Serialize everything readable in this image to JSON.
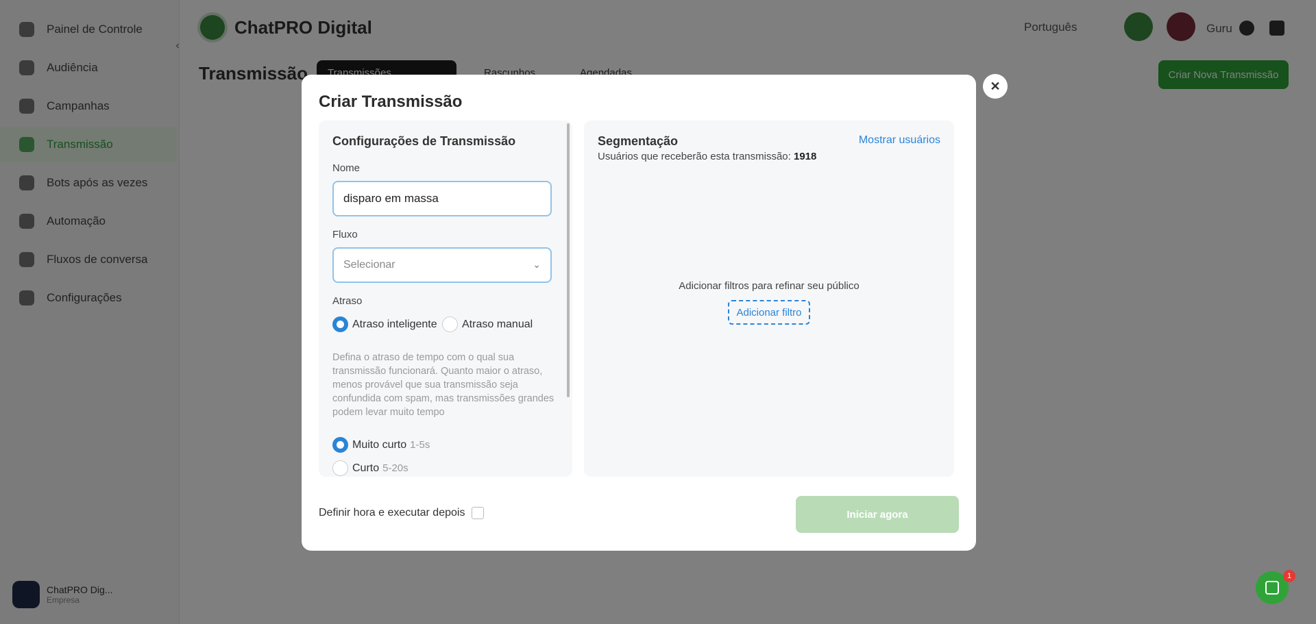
{
  "app": {
    "brand": "ChatPRO Digital",
    "language": "Português",
    "guru_label": "Guru",
    "page_title": "Transmissão",
    "tabs": [
      "Transmissões",
      "Rascunhos",
      "Agendadas"
    ],
    "create_button": "Criar Nova Transmissão",
    "sidebar": [
      "Painel de Controle",
      "Audiência",
      "Campanhas",
      "Transmissão",
      "Bots após as vezes",
      "Automação",
      "Fluxos de conversa",
      "Configurações"
    ],
    "account_name": "ChatPRO Dig...",
    "account_sub": "Empresa"
  },
  "modal": {
    "title": "Criar Transmissão",
    "close_icon": "close-icon",
    "settings": {
      "title": "Configurações de Transmissão",
      "name_label": "Nome",
      "name_value": "disparo em massa",
      "flow_label": "Fluxo",
      "flow_placeholder": "Selecionar",
      "delay_label": "Atraso",
      "delay_smart": "Atraso inteligente",
      "delay_manual": "Atraso manual",
      "help": "Defina o atraso de tempo com o qual sua transmissão funcionará. Quanto maior o atraso, menos provável que sua transmissão seja confundida com spam, mas transmissões grandes podem levar muito tempo",
      "options": [
        {
          "label": "Muito curto",
          "range": "1-5s",
          "checked": true
        },
        {
          "label": "Curto",
          "range": "5-20s",
          "checked": false
        }
      ]
    },
    "segmentation": {
      "title": "Segmentação",
      "users_label": "Usuários que receberão esta transmissão:",
      "users_count": "1918",
      "show_users": "Mostrar usuários",
      "filter_hint": "Adicionar filtros para refinar seu público",
      "add_filter": "Adicionar filtro"
    },
    "schedule_label": "Definir hora e executar depois",
    "start_button": "Iniciar agora"
  },
  "chat": {
    "badge": "1"
  }
}
